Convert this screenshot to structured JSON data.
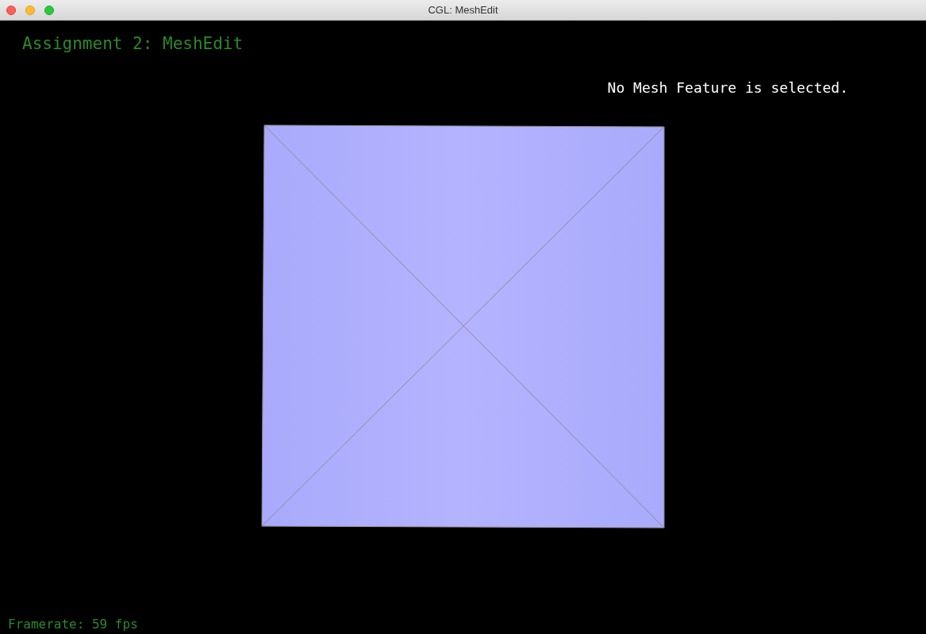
{
  "window": {
    "title": "CGL: MeshEdit"
  },
  "viewport": {
    "heading": "Assignment 2: MeshEdit",
    "selection_status": "No Mesh Feature is selected.",
    "framerate": "Framerate: 59 fps"
  }
}
